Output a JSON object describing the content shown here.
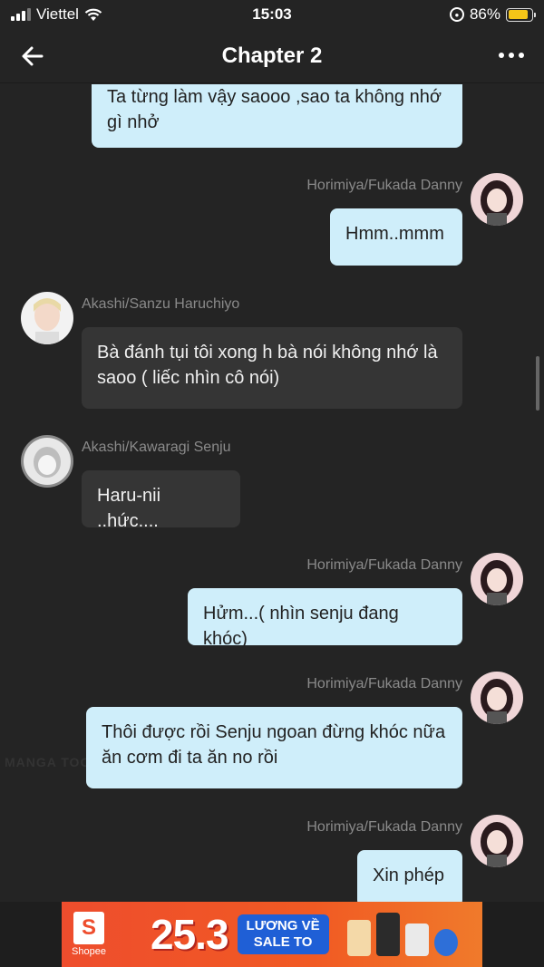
{
  "status_bar": {
    "carrier": "Viettel",
    "time": "15:03",
    "battery": "86%",
    "battery_level": 0.86
  },
  "nav": {
    "title": "Chapter 2"
  },
  "messages": [
    {
      "side": "right",
      "text": "Ta từng làm vậy saooo ,sao ta không nhớ gì nhở"
    },
    {
      "side": "right",
      "sender": "Horimiya/Fukada Danny",
      "text": "Hmm..mmm"
    },
    {
      "side": "left",
      "sender": "Akashi/Sanzu Haruchiyo",
      "text": "Bà đánh tụi tôi xong h bà nói không nhớ là saoo ( liếc nhìn cô nói)"
    },
    {
      "side": "left",
      "sender": "Akashi/Kawaragi Senju",
      "text": "Haru-nii ..hức...."
    },
    {
      "side": "right",
      "sender": "Horimiya/Fukada Danny",
      "text": "Hửm...( nhìn senju đang khóc)"
    },
    {
      "side": "right",
      "sender": "Horimiya/Fukada Danny",
      "text": "Thôi được rồi Senju ngoan đừng khóc nữa ăn cơm đi ta ăn no rồi"
    },
    {
      "side": "right",
      "sender": "Horimiya/Fukada Danny",
      "text": "Xin phép"
    }
  ],
  "watermark": "MANGA TOON",
  "ad": {
    "brand": "Shopee",
    "logo_letter": "S",
    "headline": "25.3",
    "tag_line1": "LƯƠNG VỀ",
    "tag_line2": "SALE TO",
    "accent": "#ee4d2d"
  },
  "icons": {
    "back": "arrow-left-icon",
    "more": "more-dots-icon",
    "wifi": "wifi-icon",
    "rotation_lock": "rotation-lock-icon"
  }
}
